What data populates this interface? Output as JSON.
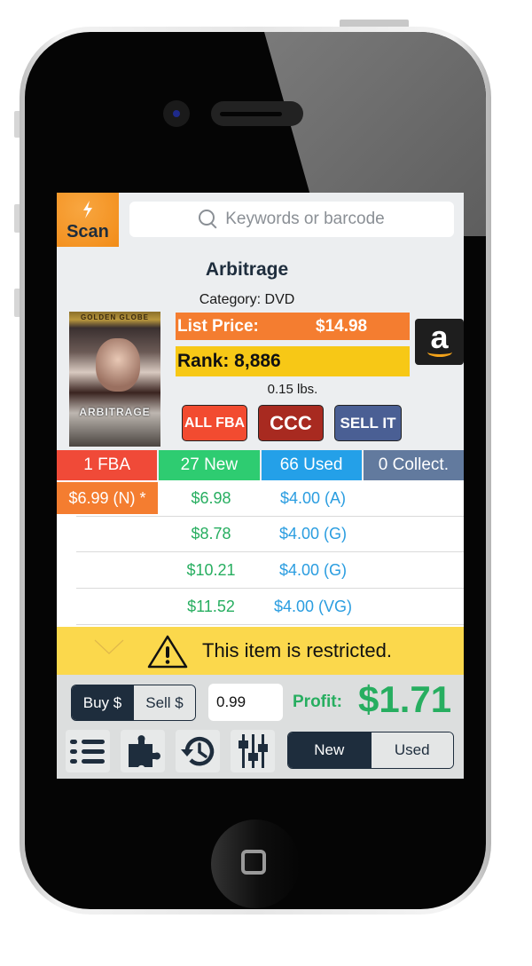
{
  "app": {
    "scan_button": {
      "label": "Scan",
      "icon": "lightning-bolt-icon"
    },
    "search": {
      "placeholder": "Keywords or barcode",
      "value": ""
    }
  },
  "product": {
    "title": "Arbitrage",
    "category": "Category: DVD",
    "cover": {
      "top_text": "GOLDEN GLOBE",
      "title_text": "ARBITRAGE"
    },
    "list_price_label": "List Price:",
    "list_price_value": "$14.98",
    "rank": "Rank: 8,886",
    "weight": "0.15 lbs.",
    "amazon_icon": "a"
  },
  "actions": {
    "all_fba": "ALL FBA",
    "ccc": "CCC",
    "sell_it": "SELL IT"
  },
  "colors": {
    "fba": "#f04a38",
    "new": "#2ecc71",
    "used": "#24a0e8",
    "collect": "#627a9e",
    "orange": "#f47d30",
    "yellow": "#f7c816",
    "navy": "#1e2d3d",
    "profit_green": "#27ae60"
  },
  "offer_tabs": [
    {
      "label": "1 FBA"
    },
    {
      "label": "27 New"
    },
    {
      "label": "66 Used"
    },
    {
      "label": "0 Collect."
    }
  ],
  "offers": [
    {
      "fba": "$6.99 (N) *",
      "new": "$6.98",
      "used": "$4.00 (A)"
    },
    {
      "fba": "",
      "new": "$8.78",
      "used": "$4.00 (G)"
    },
    {
      "fba": "",
      "new": "$10.21",
      "used": "$4.00 (G)"
    },
    {
      "fba": "",
      "new": "$11.52",
      "used": "$4.00 (VG)"
    }
  ],
  "restriction": {
    "text": "This item is restricted."
  },
  "bottom": {
    "buy_label": "Buy $",
    "sell_label": "Sell $",
    "selected_mode": "Buy $",
    "price_value": "0.99",
    "profit_label": "Profit:",
    "profit_value": "$1.71",
    "condition_new": "New",
    "condition_used": "Used",
    "selected_condition": "New",
    "tools": [
      "list-icon",
      "puzzle-icon",
      "history-icon",
      "sliders-icon"
    ]
  }
}
